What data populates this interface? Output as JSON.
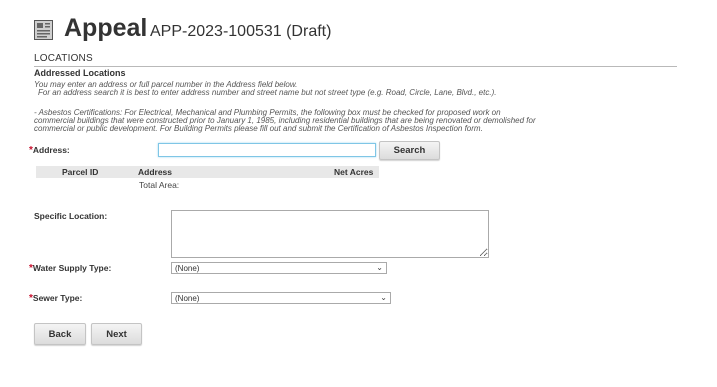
{
  "header": {
    "title": "Appeal",
    "app_id": "APP-2023-100531 (Draft)",
    "icon": "document-icon"
  },
  "section": {
    "label": "LOCATIONS",
    "subheading": "Addressed Locations",
    "help_line1": "You may enter an address or full parcel number in the Address field below.",
    "help_line2": "For an address search it is best to enter address number and street name but not street type (e.g. Road, Circle, Lane, Blvd., etc.).",
    "asbestos_line1": "- Asbestos Certifications: For Electrical, Mechanical and Plumbing Permits, the following box must be checked for proposed work on",
    "asbestos_line2": "commercial buildings that were constructed prior to January 1, 1985, including residential buildings that are being renovated or demolished for",
    "asbestos_line3": "commercial or public development. For Building Permits please fill out and submit the Certification of Asbestos Inspection form."
  },
  "form": {
    "required_marker": "*",
    "address_label": "Address:",
    "address_value": "",
    "search_label": "Search",
    "table_headers": {
      "parcel_id": "Parcel ID",
      "address": "Address",
      "net_acres": "Net Acres"
    },
    "total_area_label": "Total Area:",
    "specific_location_label": "Specific Location:",
    "specific_location_value": "",
    "water_supply_label": "Water Supply Type:",
    "water_supply_value": "(None)",
    "sewer_label": "Sewer Type:",
    "sewer_value": "(None)"
  },
  "nav": {
    "back_label": "Back",
    "next_label": "Next"
  },
  "colors": {
    "required": "#c8102e",
    "input_focus_border": "#7fc6e6",
    "table_header_bg": "#e8e8e8"
  }
}
